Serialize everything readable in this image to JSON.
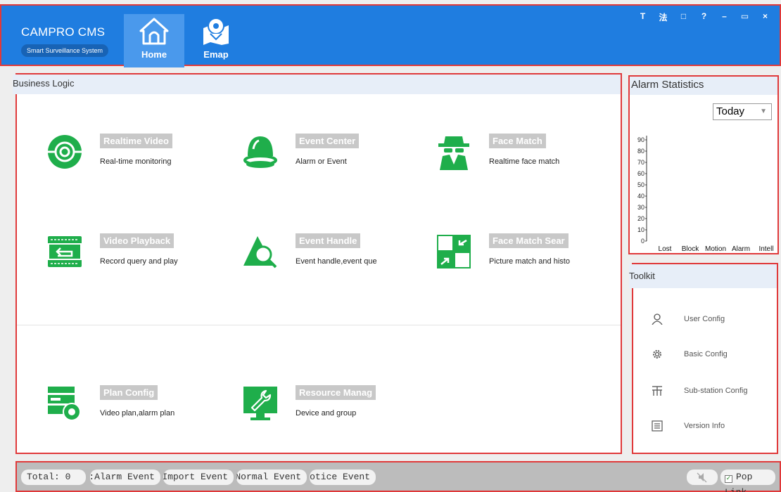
{
  "header": {
    "brand_title": "CAMPRO CMS",
    "brand_subtitle": "Smart Surveillance System",
    "tabs": [
      {
        "label": "Home",
        "icon": "home-icon",
        "active": true
      },
      {
        "label": "Emap",
        "icon": "map-pin-icon",
        "active": false
      }
    ],
    "window_controls": [
      "T",
      "法",
      "□",
      "?",
      "–",
      "▭",
      "×"
    ]
  },
  "business": {
    "title": "Business Logic",
    "tiles": [
      {
        "name": "Realtime Video",
        "desc": "Real-time monitoring",
        "icon": "camera-icon"
      },
      {
        "name": "Event Center",
        "desc": "Alarm or Event",
        "icon": "alarm-bell-icon"
      },
      {
        "name": "Face Match",
        "desc": "Realtime face match",
        "icon": "spy-face-icon"
      },
      {
        "name": "Video Playback",
        "desc": "Record query and play",
        "icon": "playback-icon"
      },
      {
        "name": "Event Handle",
        "desc": "Event handle,event que",
        "icon": "search-event-icon"
      },
      {
        "name": "Face Match Sear",
        "desc": "Picture match and histo",
        "icon": "picture-match-icon"
      },
      {
        "name": "Plan Config",
        "desc": "Video plan,alarm plan",
        "icon": "plan-config-icon"
      },
      {
        "name": "Resource Manag",
        "desc": "Device and group",
        "icon": "wrench-monitor-icon"
      }
    ]
  },
  "alarm": {
    "title": "Alarm Statistics",
    "period": "Today",
    "chart_data": {
      "type": "bar",
      "categories": [
        "Lost",
        "Block",
        "Motion",
        "Alarm",
        "Intell"
      ],
      "values": [
        0,
        0,
        0,
        0,
        0
      ],
      "ylim": [
        0,
        90
      ],
      "yticks": [
        0,
        10,
        20,
        30,
        40,
        50,
        60,
        70,
        80,
        90
      ]
    }
  },
  "toolkit": {
    "title": "Toolkit",
    "items": [
      {
        "label": "User Config",
        "icon": "user-icon"
      },
      {
        "label": "Basic Config",
        "icon": "gear-icon"
      },
      {
        "label": "Sub-station Config",
        "icon": "network-icon"
      },
      {
        "label": "Version Info",
        "icon": "list-icon"
      }
    ]
  },
  "status": {
    "total": "Total: 0",
    "alarm_event": "Alarm Event:",
    "import_event": "Import Event:",
    "normal_event": "Normal Event:",
    "notice_event": "Notice Event:",
    "pop_link": "Pop Link",
    "pop_link_checked": true
  }
}
